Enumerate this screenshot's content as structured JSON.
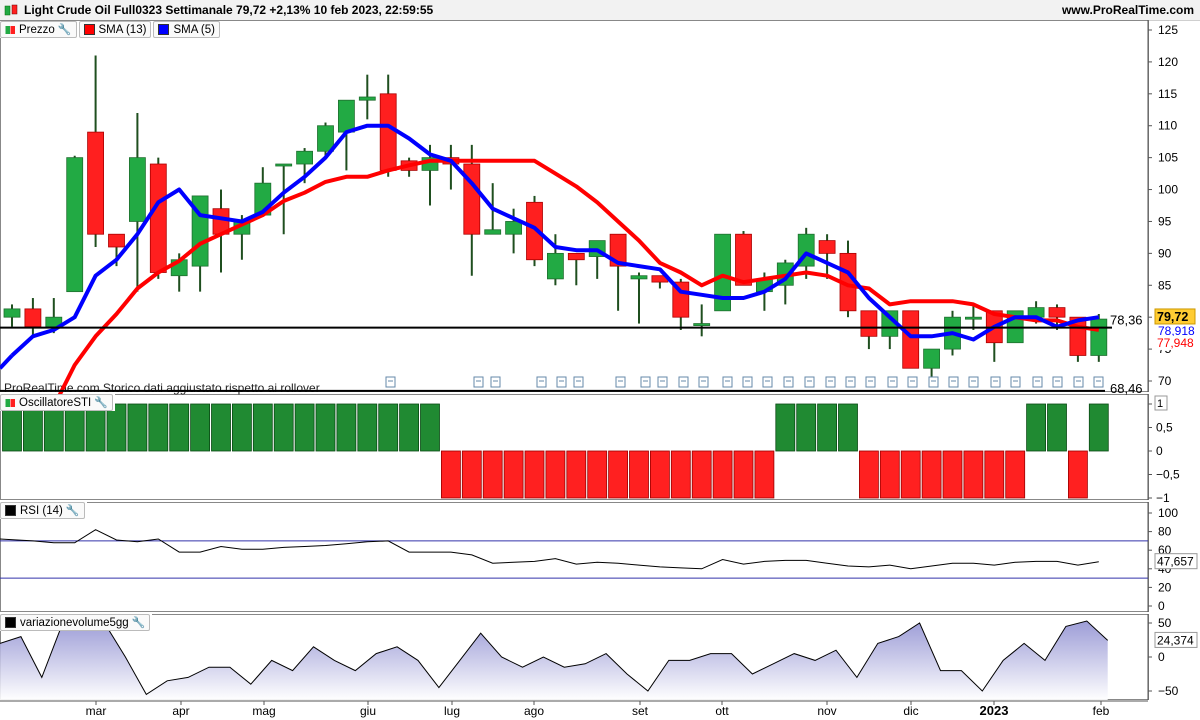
{
  "header": {
    "title": "Light Crude Oil Full0323 Settimanale 79,72 +2,13% 10 feb 2023, 22:59:55",
    "site": "www.ProRealTime.com"
  },
  "legend_price": [
    {
      "label": "Prezzo",
      "icon": "bicolor-candle-icon",
      "wrench": true
    },
    {
      "label": "SMA (13)",
      "color": "#ff0000"
    },
    {
      "label": "SMA (5)",
      "color": "#0000ff"
    }
  ],
  "legend_sti": {
    "label": "OscillatoreSTI",
    "icon": "bicolor-candle-icon",
    "wrench": true
  },
  "legend_rsi": {
    "label": "RSI (14)",
    "color": "#000000",
    "wrench": true
  },
  "legend_vol": {
    "label": "variazionevolume5gg",
    "color": "#000000",
    "wrench": true
  },
  "watermark": "ProRealTime.com Storico dati aggiustato rispetto ai rollover",
  "price_labels": {
    "last": "79,72",
    "sma13": "77,948",
    "sma5_partial": "78,918",
    "hline_upper": "78,36",
    "hline_lower": "68,46"
  },
  "rsi_label": "47,657",
  "vol_label": "24,374",
  "sti_label": "1",
  "colors": {
    "up": "#22aa44",
    "down": "#ff1f1f",
    "sma13": "#ff0000",
    "sma5": "#0000ff",
    "hline": "#000000",
    "rsi_band": "#3333aa",
    "vol_fill": "#c8c8ea",
    "last_bg": "#ffcc33"
  },
  "x_axis_months": [
    "mar",
    "apr",
    "mag",
    "giu",
    "lug",
    "ago",
    "set",
    "ott",
    "nov",
    "dic",
    "2023",
    "feb"
  ],
  "chart_data": [
    {
      "type": "candlestick",
      "title": "Light Crude Oil Full0323 Settimanale",
      "y_ticks": [
        70,
        75,
        80,
        85,
        90,
        95,
        100,
        105,
        110,
        115,
        120,
        125
      ],
      "y_tick_labels": [
        "70",
        "75",
        "80",
        "85",
        "90",
        "95",
        "100",
        "105",
        "110",
        "115",
        "120",
        "125"
      ],
      "ylim": [
        68,
        126
      ],
      "candles": [
        [
          80.0,
          81.3,
          82.0,
          78.5
        ],
        [
          81.3,
          78.5,
          83.0,
          77.0
        ],
        [
          78.5,
          80.0,
          83.0,
          77.5
        ],
        [
          84.0,
          105.0,
          105.3,
          84.0
        ],
        [
          109.0,
          93.0,
          121.0,
          91.0
        ],
        [
          93.0,
          91.0,
          93.0,
          88.0
        ],
        [
          95.0,
          105.0,
          112.0,
          84.0
        ],
        [
          104.0,
          87.0,
          105.0,
          86.0
        ],
        [
          86.5,
          89.0,
          90.0,
          84.0
        ],
        [
          88.0,
          99.0,
          99.0,
          84.0
        ],
        [
          97.0,
          93.0,
          100.0,
          87.0
        ],
        [
          93.0,
          95.0,
          96.0,
          89.0
        ],
        [
          96.0,
          101.0,
          103.5,
          96.0
        ],
        [
          104.0,
          104.0,
          104.0,
          93.0
        ],
        [
          104.0,
          106.0,
          106.5,
          101.0
        ],
        [
          106.0,
          110.0,
          110.5,
          105.0
        ],
        [
          109.0,
          114.0,
          114.0,
          103.0
        ],
        [
          114.0,
          114.5,
          118.0,
          111.0
        ],
        [
          115.0,
          103.0,
          118.0,
          102.0
        ],
        [
          104.5,
          103.0,
          105.0,
          102.0
        ],
        [
          103.0,
          105.0,
          107.0,
          97.5
        ],
        [
          105.0,
          104.0,
          107.0,
          100.0
        ],
        [
          104.0,
          93.0,
          107.0,
          86.5
        ],
        [
          93.0,
          93.7,
          101.0,
          93.0
        ],
        [
          93.0,
          95.0,
          97.0,
          90.0
        ],
        [
          98.0,
          89.0,
          99.0,
          88.0
        ],
        [
          86.0,
          90.0,
          93.0,
          85.0
        ],
        [
          90.0,
          89.0,
          90.0,
          85.0
        ],
        [
          89.5,
          92.0,
          92.0,
          86.0
        ],
        [
          93.0,
          88.0,
          93.0,
          81.0
        ],
        [
          86.0,
          86.5,
          87.0,
          79.0
        ],
        [
          86.5,
          85.5,
          86.5,
          84.5
        ],
        [
          85.5,
          80.0,
          86.0,
          78.0
        ],
        [
          79.0,
          79.0,
          82.0,
          77.0
        ],
        [
          81.0,
          93.0,
          93.0,
          81.0
        ],
        [
          93.0,
          85.0,
          93.5,
          85.0
        ],
        [
          84.0,
          86.0,
          87.0,
          81.0
        ],
        [
          85.0,
          88.5,
          89.0,
          82.0
        ],
        [
          88.0,
          93.0,
          94.0,
          86.0
        ],
        [
          92.0,
          90.0,
          93.0,
          86.0
        ],
        [
          90.0,
          81.0,
          92.0,
          80.0
        ],
        [
          81.0,
          77.0,
          81.0,
          75.0
        ],
        [
          77.0,
          81.0,
          81.0,
          75.0
        ],
        [
          81.0,
          72.0,
          81.0,
          72.0
        ],
        [
          72.0,
          75.0,
          75.0,
          70.0
        ],
        [
          75.0,
          80.0,
          81.0,
          74.0
        ],
        [
          80.0,
          80.0,
          82.0,
          78.0
        ],
        [
          81.0,
          76.0,
          81.0,
          73.0
        ],
        [
          76.0,
          81.0,
          81.0,
          76.0
        ],
        [
          80.0,
          81.5,
          82.5,
          79.0
        ],
        [
          81.5,
          80.0,
          82.0,
          78.0
        ],
        [
          80.0,
          74.0,
          80.0,
          73.0
        ],
        [
          74.0,
          79.7,
          80.5,
          73.0
        ]
      ],
      "series": [
        {
          "name": "SMA (13)",
          "values": [
            null,
            null,
            66.0,
            72.5,
            77.0,
            80.5,
            84.5,
            87.0,
            88.8,
            91.5,
            93.0,
            94.5,
            96.0,
            98.2,
            99.5,
            101.2,
            102.0,
            102.0,
            103.0,
            103.8,
            104.5,
            104.5,
            104.5,
            104.5,
            104.5,
            104.5,
            102.5,
            100.5,
            98.0,
            95.0,
            92.0,
            88.5,
            87.0,
            85.0,
            86.5,
            85.5,
            86.0,
            86.5,
            87.0,
            86.5,
            85.0,
            84.5,
            82.0,
            82.5,
            82.5,
            82.5,
            82.0,
            80.5,
            80.0,
            79.5,
            79.5,
            78.5,
            78.0
          ]
        },
        {
          "name": "SMA (5)",
          "values": [
            74.0,
            77.0,
            78.0,
            80.0,
            86.5,
            89.0,
            93.0,
            98.0,
            100.0,
            96.0,
            95.5,
            95.0,
            96.5,
            99.5,
            102.0,
            105.0,
            109.0,
            110.0,
            110.0,
            108.0,
            105.5,
            104.5,
            101.0,
            97.0,
            95.5,
            94.0,
            91.0,
            90.5,
            90.5,
            88.5,
            88.0,
            87.5,
            84.0,
            83.5,
            83.0,
            83.0,
            84.0,
            86.0,
            90.0,
            88.5,
            87.0,
            83.0,
            80.0,
            77.0,
            77.0,
            77.5,
            76.5,
            78.5,
            80.0,
            80.0,
            78.5,
            79.5,
            80.0
          ]
        }
      ],
      "hlines": [
        78.36,
        68.46
      ]
    },
    {
      "type": "bar",
      "title": "OscillatoreSTI",
      "y_ticks": [
        1,
        0.5,
        0,
        -0.5,
        -1
      ],
      "y_tick_labels": [
        "1",
        "0,5",
        "0",
        "−0,5",
        "−1"
      ],
      "ylim": [
        -1.1,
        1.1
      ],
      "values": [
        1,
        1,
        1,
        1,
        1,
        1,
        1,
        1,
        1,
        1,
        1,
        1,
        1,
        1,
        1,
        1,
        1,
        1,
        1,
        1,
        1,
        -1,
        -1,
        -1,
        -1,
        -1,
        -1,
        -1,
        -1,
        -1,
        -1,
        -1,
        -1,
        -1,
        -1,
        -1,
        -1,
        1,
        1,
        1,
        1,
        -1,
        -1,
        -1,
        -1,
        -1,
        -1,
        -1,
        -1,
        1,
        1,
        -1,
        1
      ]
    },
    {
      "type": "line",
      "title": "RSI (14)",
      "y_ticks": [
        100,
        80,
        60,
        40,
        20,
        0
      ],
      "y_tick_labels": [
        "100",
        "80",
        "60",
        "40",
        "20",
        "0"
      ],
      "ylim": [
        0,
        100
      ],
      "bands": [
        70,
        30
      ],
      "values": [
        null,
        70,
        68,
        68,
        82,
        71,
        69,
        72,
        58,
        58,
        64,
        61,
        61,
        63,
        64,
        65,
        67,
        69,
        70,
        58,
        58,
        58,
        55,
        46,
        47,
        48,
        51,
        45,
        47,
        46,
        44,
        42,
        41,
        40,
        50,
        45,
        48,
        49,
        49,
        46,
        43,
        42,
        44,
        40,
        43,
        46,
        46,
        44,
        47,
        48,
        48,
        44,
        47.657
      ]
    },
    {
      "type": "area",
      "title": "variazionevolume5gg",
      "y_ticks": [
        50,
        0,
        -50
      ],
      "y_tick_labels": [
        "50",
        "0",
        "−50"
      ],
      "ylim": [
        -62,
        58
      ],
      "values": [
        20,
        30,
        -30,
        50,
        50,
        50,
        0,
        -55,
        -35,
        -30,
        -15,
        -15,
        -40,
        -5,
        -20,
        15,
        -5,
        -20,
        5,
        15,
        -5,
        -45,
        -5,
        35,
        0,
        -15,
        0,
        -15,
        -10,
        5,
        -25,
        -50,
        -5,
        -5,
        5,
        5,
        -25,
        -10,
        5,
        -5,
        10,
        -30,
        20,
        30,
        50,
        -20,
        -20,
        -50,
        -5,
        20,
        -5,
        45,
        53,
        24.374
      ]
    }
  ]
}
